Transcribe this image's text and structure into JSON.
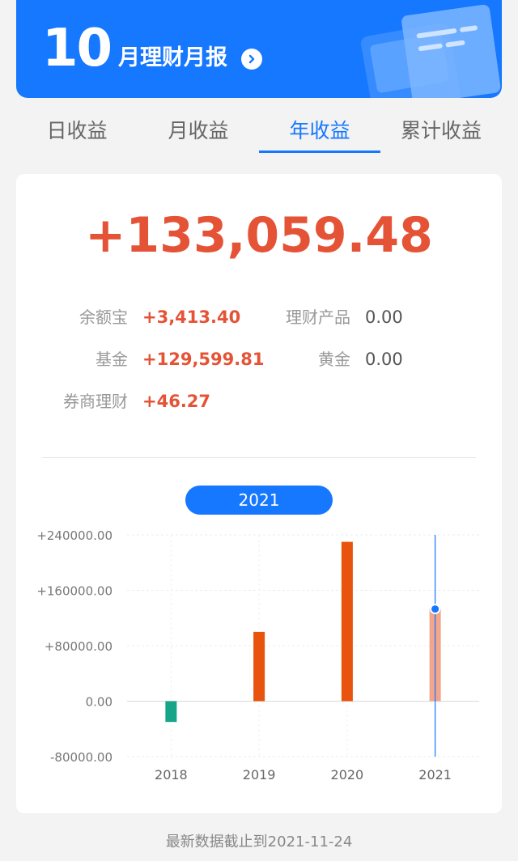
{
  "banner": {
    "month": "10",
    "title": "月理财月报"
  },
  "tabs": [
    {
      "label": "日收益",
      "active": false
    },
    {
      "label": "月收益",
      "active": false
    },
    {
      "label": "年收益",
      "active": true
    },
    {
      "label": "累计收益",
      "active": false
    }
  ],
  "summary": {
    "total": "+133,059.48",
    "items": [
      {
        "label": "余额宝",
        "value": "+3,413.40"
      },
      {
        "label": "理财产品",
        "value": "0.00"
      },
      {
        "label": "基金",
        "value": "+129,599.81"
      },
      {
        "label": "黄金",
        "value": "0.00"
      },
      {
        "label": "券商理财",
        "value": "+46.27"
      }
    ]
  },
  "selected_year": "2021",
  "colors": {
    "accent": "#1677ff",
    "positive": "#e55337",
    "bar_positive": "#e8530e",
    "bar_negative": "#17a589",
    "bar_selected": "#f3a58c"
  },
  "chart_data": {
    "type": "bar",
    "categories": [
      "2018",
      "2019",
      "2020",
      "2021"
    ],
    "values": [
      -30000,
      100000,
      230000,
      133059.48
    ],
    "y_tick_labels": [
      "+240000.00",
      "+160000.00",
      "+80000.00",
      "0.00",
      "-80000.00"
    ],
    "ylim": [
      -80000,
      240000
    ],
    "selected_category": "2021",
    "grid": true
  },
  "footer": {
    "text": "最新数据截止到2021-11-24"
  }
}
